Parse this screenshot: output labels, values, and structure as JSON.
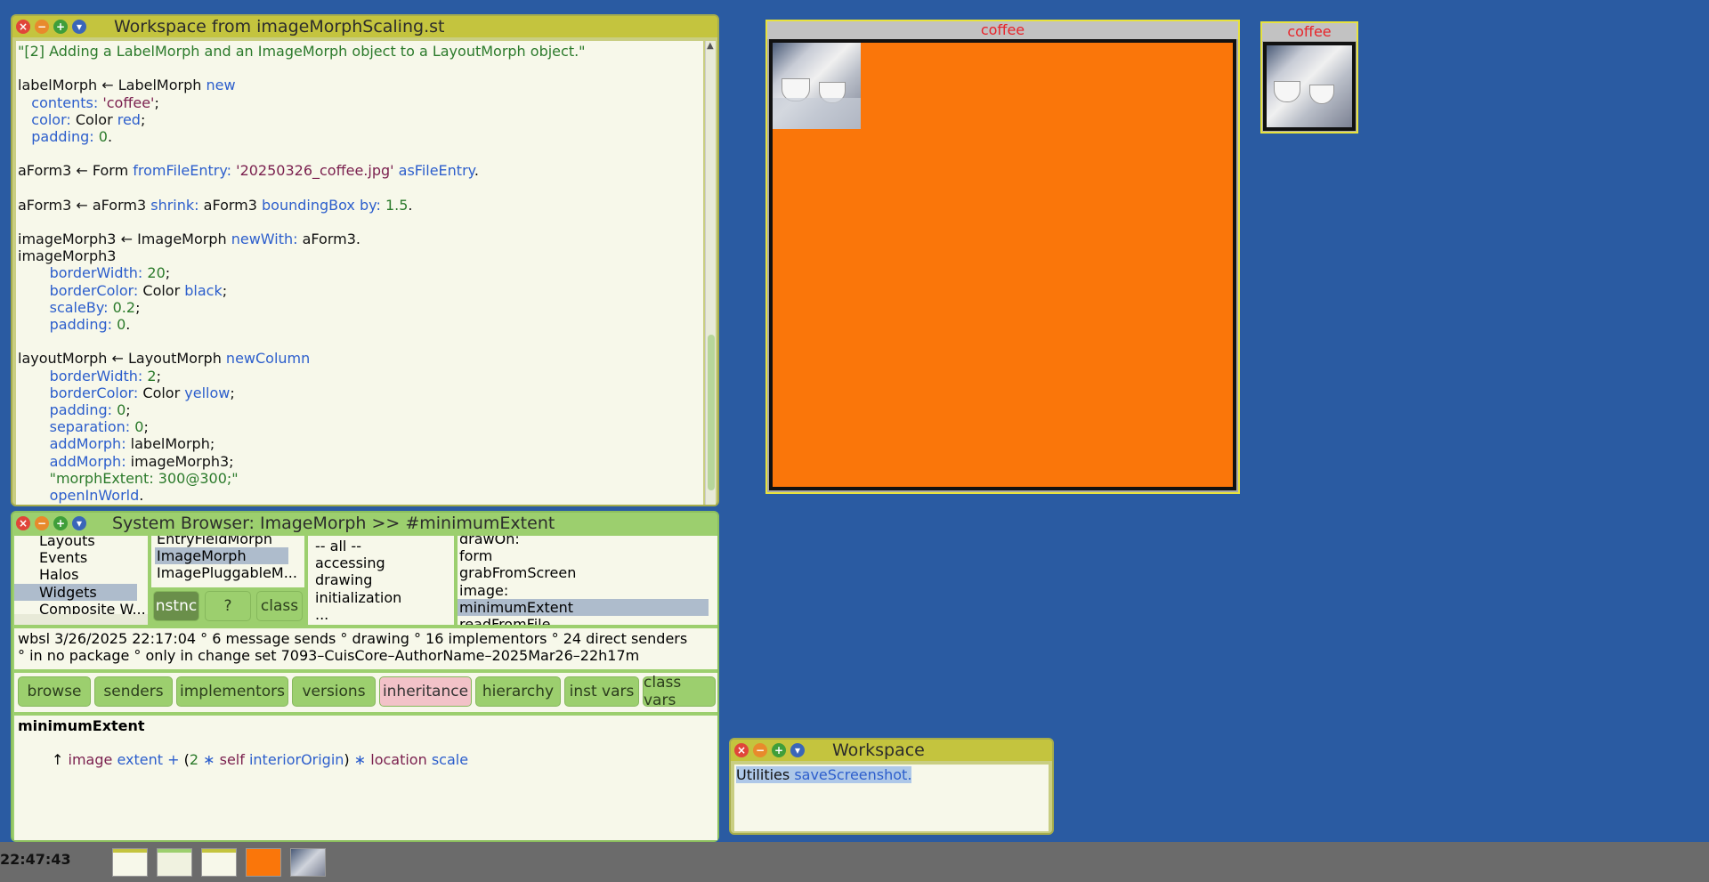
{
  "workspace1": {
    "title": "Workspace from imageMorphScaling.st",
    "code_lines": [
      [
        [
          "cmt",
          "\"[2] Adding a LabelMorph and an ImageMorph object to a LayoutMorph object.\""
        ]
      ],
      [
        [
          "t",
          ""
        ]
      ],
      [
        [
          "t",
          "labelMorph ← LabelMorph "
        ],
        [
          "kw",
          "new"
        ]
      ],
      [
        [
          "t",
          "   "
        ],
        [
          "kw",
          "contents:"
        ],
        [
          "t",
          " "
        ],
        [
          "str",
          "'coffee'"
        ],
        [
          "t",
          ";"
        ]
      ],
      [
        [
          "t",
          "   "
        ],
        [
          "kw",
          "color:"
        ],
        [
          "t",
          " Color "
        ],
        [
          "kw",
          "red"
        ],
        [
          "t",
          ";"
        ]
      ],
      [
        [
          "t",
          "   "
        ],
        [
          "kw",
          "padding:"
        ],
        [
          "t",
          " "
        ],
        [
          "num",
          "0"
        ],
        [
          "t",
          "."
        ]
      ],
      [
        [
          "t",
          ""
        ]
      ],
      [
        [
          "t",
          "aForm3 ← Form "
        ],
        [
          "kw",
          "fromFileEntry:"
        ],
        [
          "t",
          " "
        ],
        [
          "str",
          "'20250326_coffee.jpg'"
        ],
        [
          "t",
          " "
        ],
        [
          "kw",
          "asFileEntry"
        ],
        [
          "t",
          "."
        ]
      ],
      [
        [
          "t",
          ""
        ]
      ],
      [
        [
          "t",
          "aForm3 ← aForm3 "
        ],
        [
          "kw",
          "shrink:"
        ],
        [
          "t",
          " aForm3 "
        ],
        [
          "kw",
          "boundingBox"
        ],
        [
          "t",
          " "
        ],
        [
          "kw",
          "by:"
        ],
        [
          "t",
          " "
        ],
        [
          "num",
          "1.5"
        ],
        [
          "t",
          "."
        ]
      ],
      [
        [
          "t",
          ""
        ]
      ],
      [
        [
          "t",
          "imageMorph3 ← ImageMorph "
        ],
        [
          "kw",
          "newWith:"
        ],
        [
          "t",
          " aForm3."
        ]
      ],
      [
        [
          "t",
          "imageMorph3"
        ]
      ],
      [
        [
          "t",
          "       "
        ],
        [
          "kw",
          "borderWidth:"
        ],
        [
          "t",
          " "
        ],
        [
          "num",
          "20"
        ],
        [
          "t",
          ";"
        ]
      ],
      [
        [
          "t",
          "       "
        ],
        [
          "kw",
          "borderColor:"
        ],
        [
          "t",
          " Color "
        ],
        [
          "kw",
          "black"
        ],
        [
          "t",
          ";"
        ]
      ],
      [
        [
          "t",
          "       "
        ],
        [
          "kw",
          "scaleBy:"
        ],
        [
          "t",
          " "
        ],
        [
          "num",
          "0.2"
        ],
        [
          "t",
          ";"
        ]
      ],
      [
        [
          "t",
          "       "
        ],
        [
          "kw",
          "padding:"
        ],
        [
          "t",
          " "
        ],
        [
          "num",
          "0"
        ],
        [
          "t",
          "."
        ]
      ],
      [
        [
          "t",
          ""
        ]
      ],
      [
        [
          "t",
          "layoutMorph ← LayoutMorph "
        ],
        [
          "kw",
          "newColumn"
        ]
      ],
      [
        [
          "t",
          "       "
        ],
        [
          "kw",
          "borderWidth:"
        ],
        [
          "t",
          " "
        ],
        [
          "num",
          "2"
        ],
        [
          "t",
          ";"
        ]
      ],
      [
        [
          "t",
          "       "
        ],
        [
          "kw",
          "borderColor:"
        ],
        [
          "t",
          " Color "
        ],
        [
          "kw",
          "yellow"
        ],
        [
          "t",
          ";"
        ]
      ],
      [
        [
          "t",
          "       "
        ],
        [
          "kw",
          "padding:"
        ],
        [
          "t",
          " "
        ],
        [
          "num",
          "0"
        ],
        [
          "t",
          ";"
        ]
      ],
      [
        [
          "t",
          "       "
        ],
        [
          "kw",
          "separation:"
        ],
        [
          "t",
          " "
        ],
        [
          "num",
          "0"
        ],
        [
          "t",
          ";"
        ]
      ],
      [
        [
          "t",
          "       "
        ],
        [
          "kw",
          "addMorph:"
        ],
        [
          "t",
          " labelMorph;"
        ]
      ],
      [
        [
          "t",
          "       "
        ],
        [
          "kw",
          "addMorph:"
        ],
        [
          "t",
          " imageMorph3;"
        ]
      ],
      [
        [
          "t",
          "       "
        ],
        [
          "cmt",
          "\"morphExtent: 300@300;\""
        ]
      ],
      [
        [
          "t",
          "       "
        ],
        [
          "kw",
          "openInWorld"
        ],
        [
          "t",
          "."
        ]
      ]
    ]
  },
  "browser": {
    "title": "System Browser: ImageMorph >> #minimumExtent",
    "categories": [
      "Layouts",
      "Events",
      "Halos",
      "Widgets",
      "Composite W..."
    ],
    "selected_category": "Widgets",
    "classes": [
      "EntryFieldMorph",
      "ImageMorph",
      "ImagePluggableM..."
    ],
    "selected_class": "ImageMorph",
    "class_buttons": [
      "nstnc",
      "?",
      "class"
    ],
    "protocols": [
      "-- all --",
      "accessing",
      "drawing",
      "initialization",
      "..."
    ],
    "methods": [
      "drawOn:",
      "form",
      "grabFromScreen",
      "image:",
      "minimumExtent",
      "readFromFile"
    ],
    "selected_method": "minimumExtent",
    "info_line1": "wbsl 3/26/2025 22:17:04 ° 6 message sends ° drawing ° 16 implementors ° 24 direct senders",
    "info_line2": "° in no package ° only in change set 7093–CuisCore–AuthorName–2025Mar26–22h17m",
    "buttons": [
      "browse",
      "senders",
      "implementors",
      "versions",
      "inheritance",
      "hierarchy",
      "inst vars",
      "class vars"
    ],
    "method_name": "minimumExtent",
    "method_body": [
      [
        "t",
        "↑ "
      ],
      [
        "sym",
        "image"
      ],
      [
        "t",
        " "
      ],
      [
        "kw",
        "extent"
      ],
      [
        "t",
        " "
      ],
      [
        "kw",
        "+"
      ],
      [
        "t",
        " ("
      ],
      [
        "num",
        "2"
      ],
      [
        "t",
        " "
      ],
      [
        "kw",
        "∗"
      ],
      [
        "t",
        " "
      ],
      [
        "sym",
        "self"
      ],
      [
        "t",
        " "
      ],
      [
        "kw",
        "interiorOrigin"
      ],
      [
        "t",
        ") "
      ],
      [
        "kw",
        "∗"
      ],
      [
        "t",
        " "
      ],
      [
        "sym",
        "location"
      ],
      [
        "t",
        " "
      ],
      [
        "kw",
        "scale"
      ]
    ]
  },
  "coffee_large": {
    "label": "coffee"
  },
  "coffee_small": {
    "label": "coffee"
  },
  "workspace2": {
    "title": "Workspace",
    "code": [
      [
        "sel",
        "Utilities "
      ],
      [
        "selkw",
        "saveScreenshot."
      ]
    ]
  },
  "taskbar": {
    "clock": "22:47:43"
  },
  "colors": {
    "desktop": "#2a5ba2",
    "orange": "#fa760a",
    "label_red": "#e8242a",
    "title_yellow": "#c4c43e"
  }
}
